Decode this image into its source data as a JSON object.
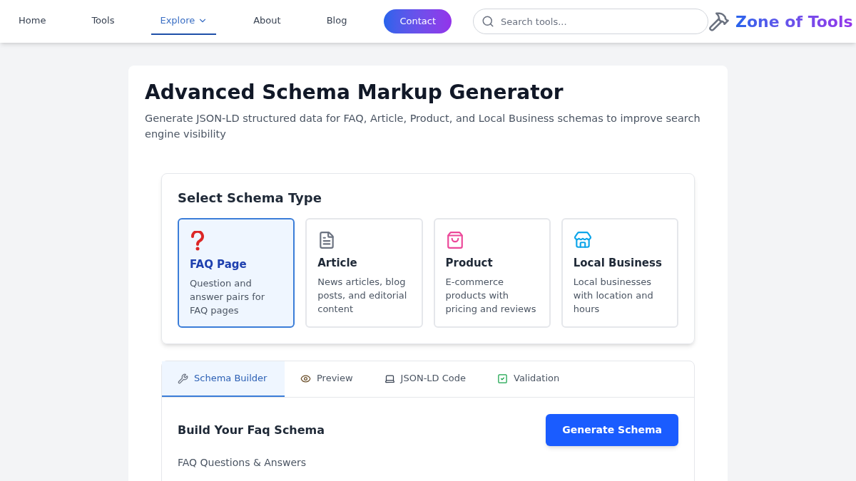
{
  "nav": {
    "items": [
      {
        "label": "Home",
        "kind": "link",
        "selected": false
      },
      {
        "label": "Tools",
        "kind": "link",
        "selected": false
      },
      {
        "label": "Explore",
        "kind": "dropdown",
        "selected": true
      },
      {
        "label": "About",
        "kind": "link",
        "selected": false
      },
      {
        "label": "Blog",
        "kind": "link",
        "selected": false
      },
      {
        "label": "Contact",
        "kind": "button",
        "selected": false
      }
    ],
    "search": {
      "placeholder": "Search tools..."
    },
    "logo": {
      "text": "Zone of Tools"
    }
  },
  "page": {
    "title": "Advanced Schema Markup Generator",
    "subtitle": "Generate JSON-LD structured data for FAQ, Article, Product, and Local Business schemas to improve search engine visibility"
  },
  "schema_type": {
    "heading": "Select Schema Type",
    "options": [
      {
        "kind": "faq",
        "name": "FAQ Page",
        "description": "Question and answer pairs for FAQ pages",
        "selected": true
      },
      {
        "kind": "article",
        "name": "Article",
        "description": "News articles, blog posts, and editorial content",
        "selected": false
      },
      {
        "kind": "product",
        "name": "Product",
        "description": "E-commerce products with pricing and reviews",
        "selected": false
      },
      {
        "kind": "local",
        "name": "Local Business",
        "description": "Local businesses with location and hours",
        "selected": false
      }
    ]
  },
  "builder": {
    "tabs": [
      {
        "kind": "builder",
        "label": "Schema Builder",
        "selected": true
      },
      {
        "kind": "preview",
        "label": "Preview",
        "selected": false
      },
      {
        "kind": "code",
        "label": "JSON-LD Code",
        "selected": false
      },
      {
        "kind": "validation",
        "label": "Validation",
        "selected": false
      }
    ],
    "heading": "Build Your Faq Schema",
    "generate_button": "Generate Schema",
    "section_label": "FAQ Questions & Answers"
  }
}
